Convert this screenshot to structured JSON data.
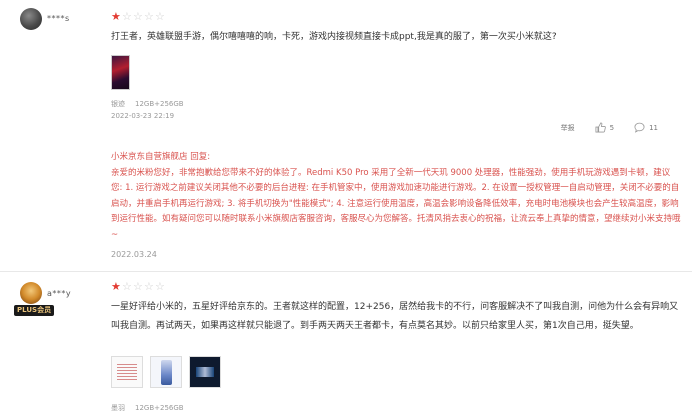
{
  "reviews": [
    {
      "username": "****s",
      "rating": 1,
      "rating_max": 5,
      "content": "打王者，英雄联盟手游，偶尔嘻嘻嘻的响，卡死，游戏内接视频直接卡成ppt,我是真的服了，第一次买小米就这?",
      "variant": "银迹",
      "spec": "12GB+256GB",
      "date": "2022-03-23 22:19",
      "report_label": "举报",
      "like_count": "5",
      "comment_count": "11",
      "reply": {
        "author": "小米京东自营旗舰店 回复:",
        "text": "亲爱的米粉您好，非常抱歉给您带来不好的体验了。Redmi K50 Pro 采用了全新一代天玑 9000 处理器，性能强劲，使用手机玩游戏遇到卡顿，建议您: 1. 运行游戏之前建议关闭其他不必要的后台进程: 在手机管家中，使用游戏加速功能进行游戏。2. 在设置一授权管理一自启动管理，关闭不必要的自启动，并重启手机再运行游戏; 3. 将手机切换为\"性能模式\"; 4. 注意运行使用温度，高温会影响设备降低效率，充电时电池模块也会产生较高温度，影响到运行性能。如有疑问您可以随时联系小米旗舰店客服咨询，客服尽心为您解答。托清风捎去衷心的祝福，让流云奉上真挚的情意，望继续对小米支持哦~",
        "date": "2022.03.24"
      }
    },
    {
      "username": "a***y",
      "badge": "PLUS会员",
      "rating": 1,
      "rating_max": 5,
      "content": "一星好评给小米的，五星好评给京东的。王者就这样的配置，12+256，居然给我卡的不行，问客服解决不了叫我自测，问他为什么会有异响又叫我自测。再试两天，如果再这样就只能退了。到手两天两天王者都卡，有点莫名其妙。以前只给家里人买，第1次自己用，挺失望。",
      "variant": "墨羽",
      "spec": "12GB+256GB"
    }
  ],
  "icons": {
    "avatar_1": "avatar",
    "avatar_2": "avatar",
    "star": "star-icon",
    "like": "thumbs-up-icon",
    "comment": "comment-icon"
  },
  "colors": {
    "star_active": "#e23b32",
    "star_inactive": "#cfcfcf",
    "reply_text": "#d9534f",
    "meta_text": "#999999"
  }
}
